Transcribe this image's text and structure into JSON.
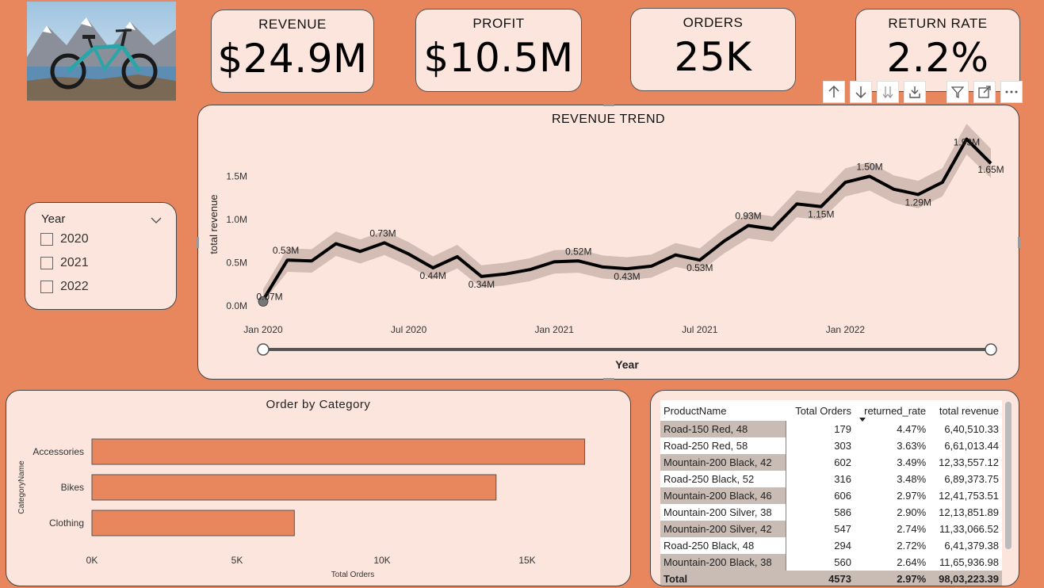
{
  "kpis": {
    "revenue": {
      "label": "REVENUE",
      "value": "$24.9M"
    },
    "profit": {
      "label": "PROFIT",
      "value": "$10.5M"
    },
    "orders": {
      "label": "ORDERS",
      "value": "25K"
    },
    "return_rate": {
      "label": "RETURN RATE",
      "value": "2.2%"
    }
  },
  "toolbar": {
    "icons": [
      "drill-up-icon",
      "drill-down-icon",
      "next-level-icon",
      "expand-hierarchy-icon",
      "filter-icon",
      "focus-mode-icon",
      "more-options-icon"
    ]
  },
  "slicer": {
    "header": "Year",
    "options": [
      {
        "label": "2020",
        "checked": false
      },
      {
        "label": "2021",
        "checked": false
      },
      {
        "label": "2022",
        "checked": false
      }
    ]
  },
  "revenue_trend": {
    "title": "REVENUE TREND",
    "ylabel": "total revenue",
    "xlabel": "Year"
  },
  "order_category": {
    "title": "Order by Category",
    "ylabel": "CategoryName",
    "xlabel": "Total Orders"
  },
  "table": {
    "headers": [
      "ProductName",
      "Total Orders",
      "returned_rate",
      "total revenue"
    ],
    "rows": [
      [
        "Road-150 Red, 48",
        "179",
        "4.47%",
        "6,40,510.33"
      ],
      [
        "Road-250 Red, 58",
        "303",
        "3.63%",
        "6,61,013.44"
      ],
      [
        "Mountain-200 Black, 42",
        "602",
        "3.49%",
        "12,33,557.12"
      ],
      [
        "Road-250 Black, 52",
        "316",
        "3.48%",
        "6,89,373.75"
      ],
      [
        "Mountain-200 Black, 46",
        "606",
        "2.97%",
        "12,41,753.51"
      ],
      [
        "Mountain-200 Silver, 38",
        "586",
        "2.90%",
        "12,13,851.89"
      ],
      [
        "Mountain-200 Silver, 42",
        "547",
        "2.74%",
        "11,33,066.52"
      ],
      [
        "Road-250 Black, 48",
        "294",
        "2.72%",
        "6,41,379.38"
      ],
      [
        "Mountain-200 Black, 38",
        "560",
        "2.64%",
        "11,65,936.98"
      ]
    ],
    "total": [
      "Total",
      "4573",
      "2.97%",
      "98,03,223.39"
    ],
    "sort_column": "returned_rate"
  },
  "colors": {
    "background": "#E8875E",
    "card": "#FBE5DD",
    "bar": "#E8875E",
    "line": "#000000",
    "band": "#C9B3AB"
  },
  "chart_data": [
    {
      "type": "line",
      "title": "REVENUE TREND",
      "xlabel": "Year",
      "ylabel": "total revenue",
      "x": [
        "2020-01",
        "2020-02",
        "2020-03",
        "2020-04",
        "2020-05",
        "2020-06",
        "2020-07",
        "2020-08",
        "2020-09",
        "2020-10",
        "2020-11",
        "2020-12",
        "2021-01",
        "2021-02",
        "2021-03",
        "2021-04",
        "2021-05",
        "2021-06",
        "2021-07",
        "2021-08",
        "2021-09",
        "2021-10",
        "2021-11",
        "2021-12",
        "2022-01",
        "2022-02",
        "2022-03",
        "2022-04",
        "2022-05",
        "2022-06"
      ],
      "series": [
        {
          "values": [
            0.07,
            0.53,
            0.52,
            0.72,
            0.63,
            0.73,
            0.6,
            0.44,
            0.57,
            0.34,
            0.37,
            0.42,
            0.51,
            0.52,
            0.45,
            0.43,
            0.46,
            0.59,
            0.53,
            0.75,
            0.93,
            0.89,
            1.18,
            1.15,
            1.43,
            1.5,
            1.35,
            1.29,
            1.43,
            1.93,
            1.65
          ]
        }
      ],
      "data_labels": [
        {
          "x": "2020-01",
          "text": "0.07M"
        },
        {
          "x": "2020-02",
          "text": "0.53M"
        },
        {
          "x": "2020-06",
          "text": "0.73M"
        },
        {
          "x": "2020-08",
          "text": "0.44M"
        },
        {
          "x": "2020-10",
          "text": "0.34M"
        },
        {
          "x": "2021-02",
          "text": "0.52M"
        },
        {
          "x": "2021-04",
          "text": "0.43M"
        },
        {
          "x": "2021-07",
          "text": "0.53M"
        },
        {
          "x": "2021-09",
          "text": "0.93M"
        },
        {
          "x": "2021-12",
          "text": "1.15M"
        },
        {
          "x": "2022-02",
          "text": "1.50M"
        },
        {
          "x": "2022-04",
          "text": "1.29M"
        },
        {
          "x": "2022-06",
          "text": "1.93M"
        },
        {
          "x": "2022-07",
          "text": "1.65M"
        }
      ],
      "y_ticks": [
        "0.0M",
        "0.5M",
        "1.0M",
        "1.5M"
      ],
      "x_ticks": [
        "Jan 2020",
        "Jul 2020",
        "Jan 2021",
        "Jul 2021",
        "Jan 2022"
      ],
      "ylim": [
        0,
        2.0
      ],
      "grid": false
    },
    {
      "type": "bar",
      "orientation": "horizontal",
      "title": "Order by Category",
      "xlabel": "Total Orders",
      "ylabel": "CategoryName",
      "categories": [
        "Accessories",
        "Bikes",
        "Clothing"
      ],
      "values": [
        16983,
        13929,
        6976
      ],
      "x_ticks": [
        "0K",
        "5K",
        "10K",
        "15K"
      ],
      "xlim": [
        0,
        17500
      ]
    }
  ]
}
